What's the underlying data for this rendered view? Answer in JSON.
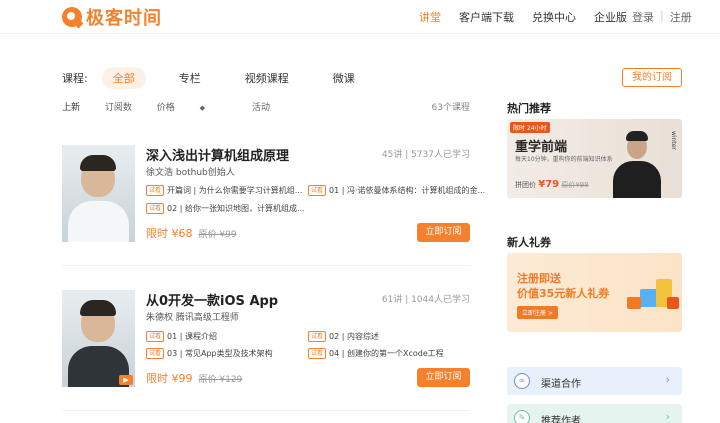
{
  "header": {
    "brand": "极客时间",
    "nav": [
      "讲堂",
      "客户端下载",
      "兑换中心",
      "企业版"
    ],
    "login": "登录",
    "separator": "|",
    "register": "注册"
  },
  "filters": {
    "label": "课程:",
    "tabs": [
      "全部",
      "专栏",
      "视频课程",
      "微课"
    ],
    "my_subscriptions": "我的订阅"
  },
  "sort": {
    "options": [
      "上新",
      "订阅数",
      "价格",
      "活动"
    ],
    "price_arrow": "◆",
    "total": "63个课程"
  },
  "courses": [
    {
      "title": "深入浅出计算机组成原理",
      "stats": "45讲 | 5737人已学习",
      "author": "徐文浩 bothub创始人",
      "lessons": [
        {
          "tag": "试看",
          "text": "开篇词 | 为什么你需要学习计算机组..."
        },
        {
          "tag": "试看",
          "text": "01 | 冯·诺依曼体系结构：计算机组成的金..."
        },
        {
          "tag": "试看",
          "text": "02 | 给你一张知识地图，计算机组成..."
        }
      ],
      "price": "限时 ¥68",
      "original_label": "原价",
      "original_price": "¥99",
      "buy": "立即订阅"
    },
    {
      "title": "从0开发一款iOS App",
      "stats": "61讲 | 1044人已学习",
      "author": "朱德权 腾讯高级工程师",
      "lessons": [
        {
          "tag": "试看",
          "text": "01 | 课程介绍"
        },
        {
          "tag": "试看",
          "text": "02 | 内容综述"
        },
        {
          "tag": "试看",
          "text": "03 | 常见App类型及技术架构"
        },
        {
          "tag": "试看",
          "text": "04 | 创建你的第一个Xcode工程"
        }
      ],
      "price": "限时 ¥99",
      "original_label": "原价",
      "original_price": "¥129",
      "buy": "立即订阅"
    }
  ],
  "sidebar": {
    "hot_title": "热门推荐",
    "hot_banner": {
      "tag": "限时 24小时",
      "title": "重学前端",
      "subtitle": "每天10分钟，重构你的前端知识体系",
      "price_label": "拼团价",
      "price": "¥79",
      "original_label": "原价",
      "original_price": "¥99",
      "vertical_text": "winter"
    },
    "gift_title": "新人礼券",
    "gift_banner": {
      "line1": "注册即送",
      "line2": "价值35元新人礼券",
      "button": "立即注册 >"
    },
    "links": [
      {
        "label": "渠道合作",
        "icon": "link-icon"
      },
      {
        "label": "推荐作者",
        "icon": "pen-icon"
      }
    ],
    "colors": {
      "accent": "#f5802d"
    }
  }
}
